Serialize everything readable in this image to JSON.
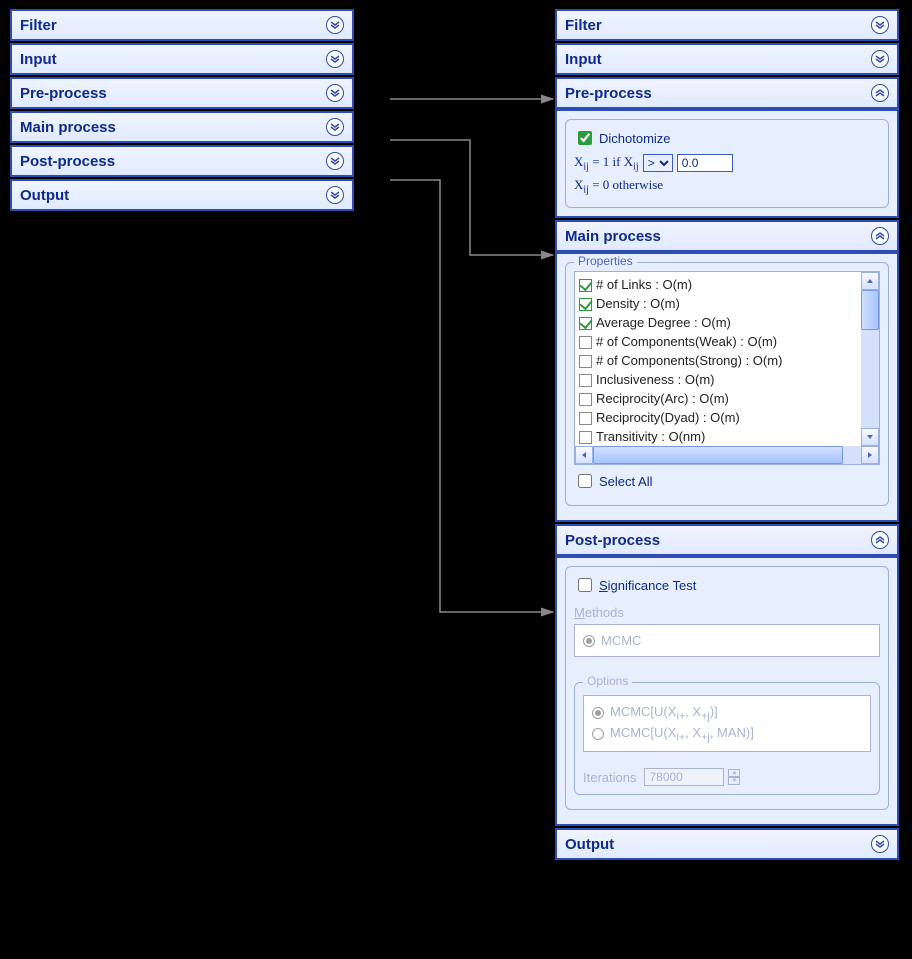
{
  "panels": {
    "filter": "Filter",
    "input": "Input",
    "preprocess": "Pre-process",
    "mainprocess": "Main process",
    "postprocess": "Post-process",
    "output": "Output"
  },
  "preprocess": {
    "dichotomize_label": "Dichotomize",
    "dichotomize_checked": true,
    "xij_eq1": "X",
    "xij_sub": "ij",
    "xij_eq1_txt": " = 1 if X",
    "comparator_options": [
      ">",
      ">=",
      "<",
      "<=",
      "="
    ],
    "comparator_selected": ">",
    "threshold": "0.0",
    "xij_eq0": "X",
    "xij_eq0_txt": " = 0 otherwise"
  },
  "main": {
    "properties_group_label": "Properties",
    "items": [
      {
        "checked": true,
        "label": "# of Links : O(m)"
      },
      {
        "checked": true,
        "label": "Density : O(m)"
      },
      {
        "checked": true,
        "label": "Average Degree : O(m)"
      },
      {
        "checked": false,
        "label": "# of Components(Weak) : O(m)"
      },
      {
        "checked": false,
        "label": "# of Components(Strong) : O(m)"
      },
      {
        "checked": false,
        "label": "Inclusiveness : O(m)"
      },
      {
        "checked": false,
        "label": "Reciprocity(Arc) : O(m)"
      },
      {
        "checked": false,
        "label": "Reciprocity(Dyad) : O(m)"
      },
      {
        "checked": false,
        "label": "Transitivity : O(nm)"
      }
    ],
    "select_all_label": "Select All",
    "select_all_checked": false
  },
  "post": {
    "significance_label": "Significance Test",
    "significance_checked": false,
    "methods_label": "Methods",
    "method_mcmc": "MCMC",
    "options_label": "Options",
    "opt1": "MCMC[U(X",
    "opt1_sub1": "i+",
    "opt1_mid": ", X",
    "opt1_sub2": "+j",
    "opt1_end": ")]",
    "opt2": "MCMC[U(X",
    "opt2_sub1": "i+",
    "opt2_mid": ", X",
    "opt2_sub2": "+j",
    "opt2_end": ", MAN)]",
    "iterations_label": "Iterations",
    "iterations_value": "78000"
  }
}
